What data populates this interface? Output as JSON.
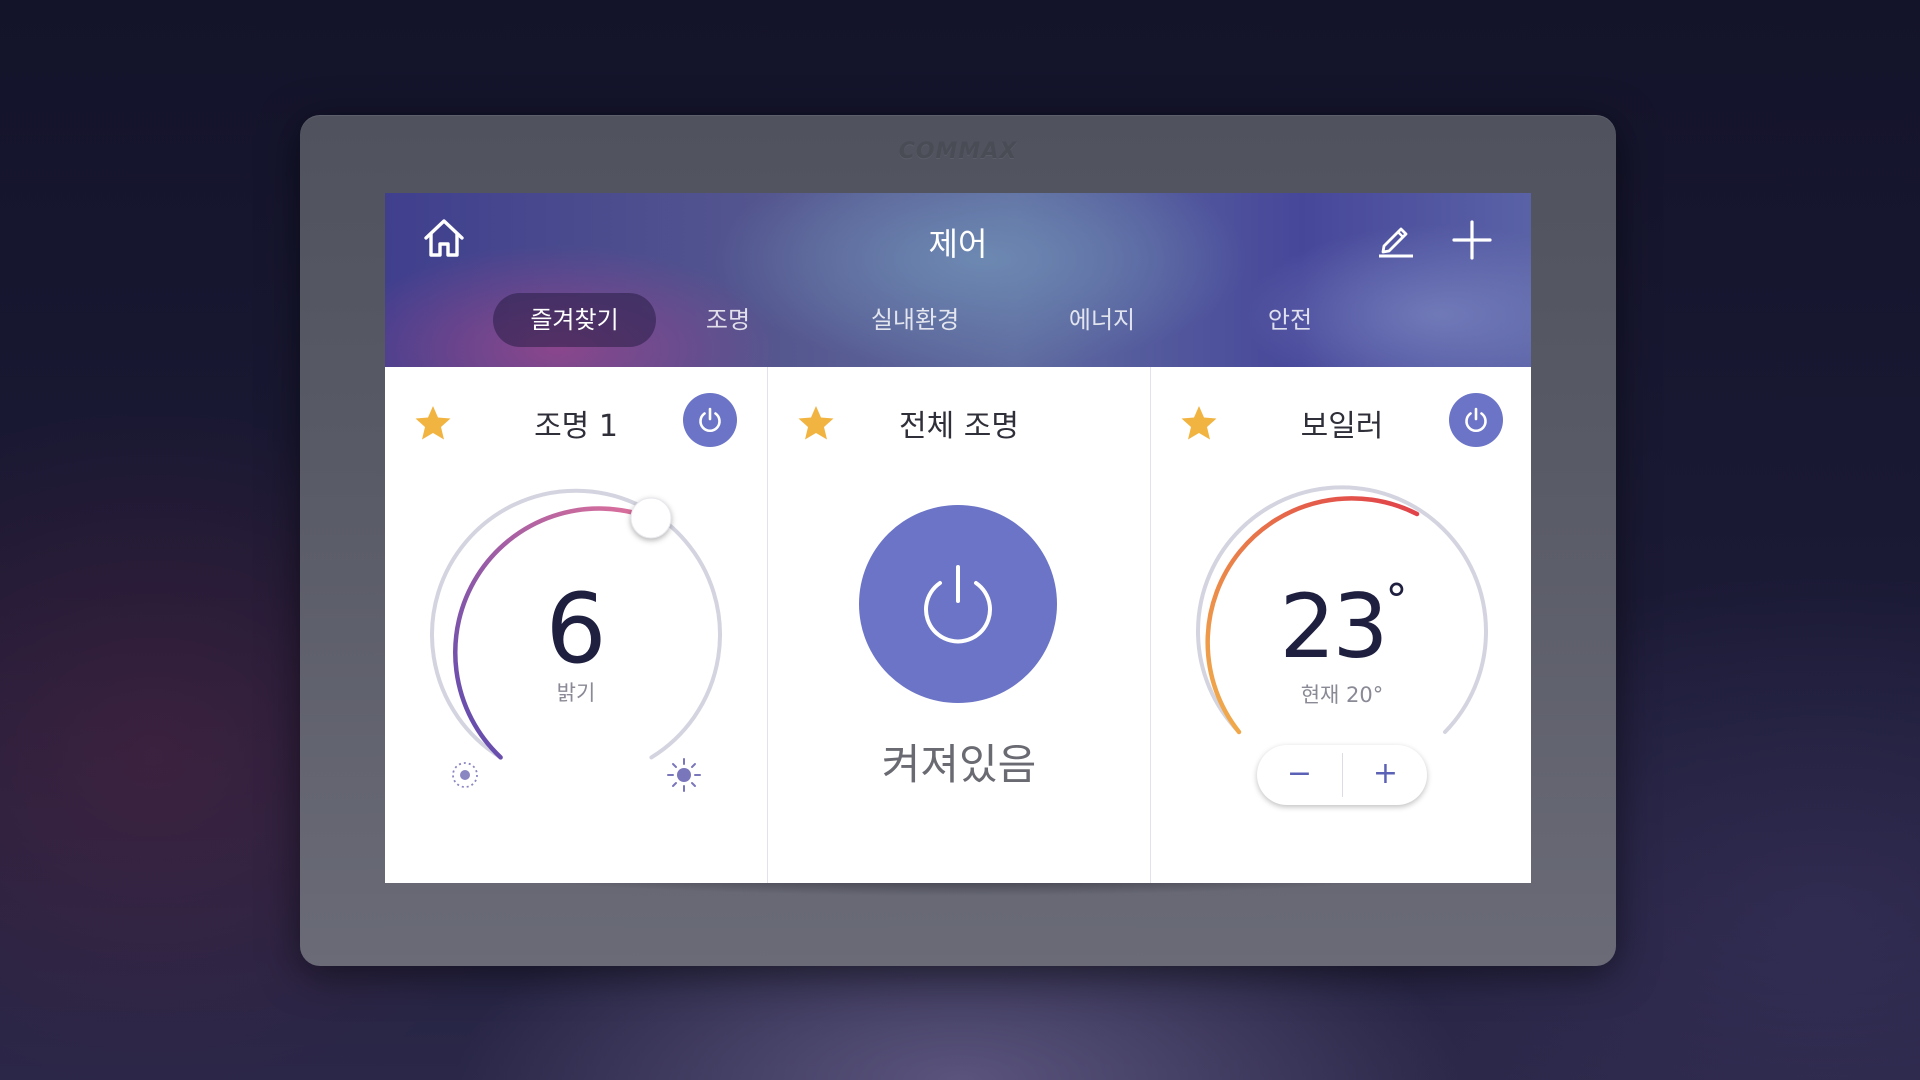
{
  "device": {
    "brand": "COMMAX"
  },
  "header": {
    "title": "제어",
    "home_icon": "home-icon",
    "edit_icon": "pencil-icon",
    "add_icon": "plus-icon"
  },
  "tabs": [
    {
      "label": "즐겨찾기",
      "active": true
    },
    {
      "label": "조명",
      "active": false
    },
    {
      "label": "실내환경",
      "active": false
    },
    {
      "label": "에너지",
      "active": false
    },
    {
      "label": "안전",
      "active": false
    }
  ],
  "cards": {
    "light1": {
      "title": "조명 1",
      "favorite": true,
      "power_on": true,
      "value": "6",
      "value_label": "밝기",
      "level_fraction": 0.6
    },
    "all_lights": {
      "title": "전체 조명",
      "favorite": true,
      "state": "켜져있음"
    },
    "boiler": {
      "title": "보일러",
      "favorite": true,
      "power_on": true,
      "target_temp": "23",
      "degree_symbol": "°",
      "current_label": "현재 20°",
      "minus_label": "−",
      "plus_label": "+"
    }
  },
  "colors": {
    "accent": "#6b74c6",
    "star": "#f2b441",
    "arc_track": "#d4d4e0",
    "dim_gradient": [
      "#5a4ab0",
      "#e0709a"
    ],
    "heat_gradient": [
      "#f1b04a",
      "#e0404a"
    ]
  }
}
